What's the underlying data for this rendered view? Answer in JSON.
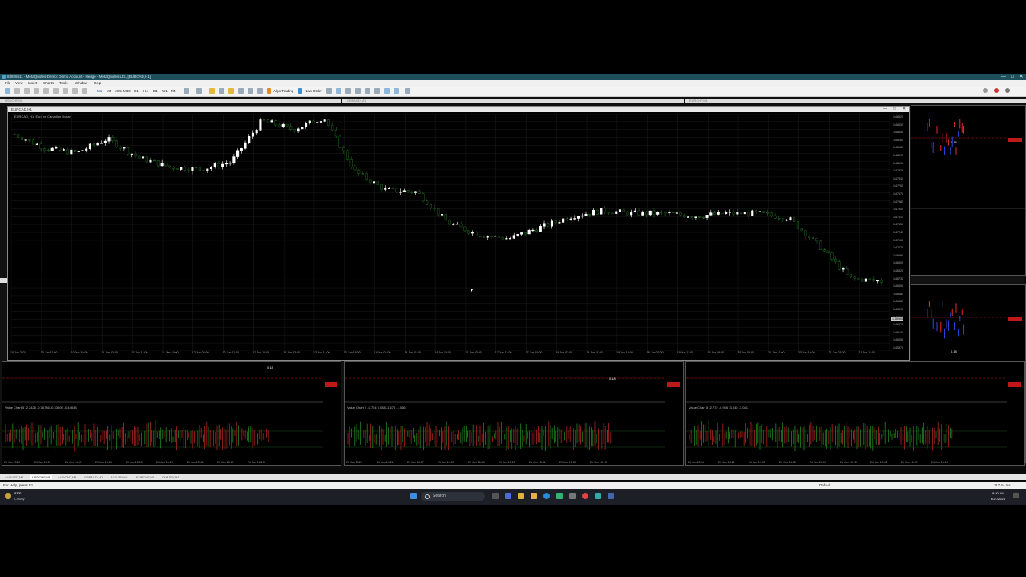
{
  "window": {
    "title": "83926611 - MetaQuotes-Demo: Demo Account - Hedge - MetaQuotes Ltd., [EURCAD,H1]",
    "controls": [
      "—",
      "□",
      "✕"
    ]
  },
  "menu": [
    "File",
    "View",
    "Insert",
    "Charts",
    "Tools",
    "Window",
    "Help"
  ],
  "toolbar": {
    "timeframes": [
      "M1",
      "M5",
      "M15",
      "M30",
      "H1",
      "H4",
      "D1",
      "W1",
      "MN"
    ],
    "algo_trading": "Algo Trading",
    "new_order": "New Order"
  },
  "child_windows": {
    "left_top": "USDCHF,M1",
    "middle_top": "GBPAUD,M1",
    "right_top": "EURCHF,M1",
    "left_bottom": "AUDUSD,M1"
  },
  "main_chart": {
    "window_title": "EURCAD,H1",
    "symbol_label": "EURCAD, H1: Euro vs Canadian Dollar",
    "x_ticks": [
      "10 Jun 2024",
      "10 Jun 11:00",
      "10 Jun 19:00",
      "11 Jun 03:00",
      "11 Jun 11:00",
      "11 Jun 19:00",
      "12 Jun 03:00",
      "12 Jun 11:00",
      "12 Jun 19:00",
      "13 Jun 03:00",
      "13 Jun 11:00",
      "13 Jun 19:00",
      "14 Jun 03:00",
      "14 Jun 11:00",
      "14 Jun 19:00",
      "17 Jun 03:00",
      "17 Jun 11:00",
      "17 Jun 19:00",
      "18 Jun 03:00",
      "18 Jun 11:00",
      "18 Jun 19:00",
      "19 Jun 03:00",
      "19 Jun 11:00",
      "19 Jun 19:00",
      "20 Jun 03:00",
      "20 Jun 11:00",
      "20 Jun 19:00",
      "21 Jun 03:00",
      "21 Jun 11:00"
    ],
    "y_ticks": [
      "1.48520",
      "1.48435",
      "1.48350",
      "1.48265",
      "1.48180",
      "1.48095",
      "1.48010",
      "1.47925",
      "1.47840",
      "1.47755",
      "1.47670",
      "1.47585",
      "1.47500",
      "1.47415",
      "1.47330",
      "1.47245",
      "1.47160",
      "1.47075",
      "1.46990",
      "1.46905",
      "1.46820",
      "1.46735",
      "1.46650",
      "1.46565",
      "1.46480",
      "1.46395",
      "1.46310",
      "1.46225",
      "1.46140",
      "1.46055",
      "1.45970"
    ],
    "bid_label": "1.46985"
  },
  "sub_charts": [
    {
      "name": "USDCHF,M1",
      "indicator": "Value Chart 5 -2.2426 -0.76786 -0.33609 -0.44643",
      "marker": "0.18",
      "x_ticks": [
        "21 Jun 2024",
        "21 Jun 14:21",
        "21 Jun 14:37",
        "21 Jun 14:53",
        "21 Jun 15:09",
        "21 Jun 15:25",
        "21 Jun 15:41",
        "21 Jun 15:57",
        "21 Jun 16:13"
      ]
    },
    {
      "name": "GBPAUD,M1",
      "indicator": "Value Chart 5 -0.754 0.088 -1.676 -1.066",
      "marker": "0.18",
      "x_ticks": [
        "21 Jun 2024",
        "21 Jun 14:21",
        "21 Jun 14:37",
        "21 Jun 14:53",
        "21 Jun 15:09",
        "21 Jun 15:25",
        "21 Jun 15:41",
        "21 Jun 15:57",
        "21 Jun 16:13"
      ]
    },
    {
      "name": "EURCHF,M1",
      "indicator": "Value Chart 5 -2.772 -0.955 -3.045 -3.081",
      "marker": "0.18",
      "x_ticks": [
        "21 Jun 2024",
        "21 Jun 14:21",
        "21 Jun 14:37",
        "21 Jun 14:53",
        "21 Jun 15:09",
        "21 Jun 15:25",
        "21 Jun 15:41",
        "21 Jun 15:57",
        "21 Jun 16:13"
      ]
    }
  ],
  "right_panel_marker": "0.18",
  "tabs": [
    "AUDUSD,M1",
    "USDCHF,M1",
    "AUDCAD,M1",
    "GBPAUD,M1",
    "AUDJPY,M1",
    "EURCHF,M1",
    "CHFJPY,M1"
  ],
  "status": {
    "help": "For Help, press F1",
    "profile": "Default",
    "traffic": "117.44 ms"
  },
  "taskbar": {
    "weather_temp": "83°F",
    "weather_desc": "Cloudy",
    "search_label": "Search",
    "time": "8:20 AM",
    "date": "6/21/2024"
  },
  "colors": {
    "bull": "#ffffff",
    "bear": "#1f6b1f",
    "grid": "#1c1c1c",
    "titlebar": "#1e4f5d",
    "sell_level": "#ff2020",
    "buy_level": "#2030ff"
  },
  "chart_data": {
    "type": "line",
    "title": "EURCAD, H1: Euro vs Canadian Dollar",
    "xlabel": "",
    "ylabel": "",
    "ylim": [
      1.4597,
      1.4852
    ],
    "x": [
      "10 Jun 2024",
      "10 Jun 11:00",
      "10 Jun 19:00",
      "11 Jun 03:00",
      "11 Jun 11:00",
      "11 Jun 19:00",
      "12 Jun 03:00",
      "12 Jun 11:00",
      "12 Jun 19:00",
      "13 Jun 03:00",
      "13 Jun 11:00",
      "13 Jun 19:00",
      "14 Jun 03:00",
      "14 Jun 11:00",
      "14 Jun 19:00",
      "17 Jun 03:00",
      "17 Jun 11:00",
      "17 Jun 19:00",
      "18 Jun 03:00",
      "18 Jun 11:00",
      "18 Jun 19:00",
      "19 Jun 03:00",
      "19 Jun 11:00",
      "19 Jun 19:00",
      "20 Jun 03:00",
      "20 Jun 11:00",
      "20 Jun 19:00",
      "21 Jun 03:00",
      "21 Jun 11:00"
    ],
    "series": [
      {
        "values": [
          1.483,
          1.4815,
          1.481,
          1.4825,
          1.4805,
          1.4795,
          1.4792,
          1.48,
          1.4845,
          1.4835,
          1.4848,
          1.479,
          1.477,
          1.4768,
          1.4735,
          1.4722,
          1.4718,
          1.473,
          1.4742,
          1.4748,
          1.4745,
          1.4745,
          1.4742,
          1.4745,
          1.4745,
          1.474,
          1.471,
          1.4675,
          1.4672
        ]
      }
    ]
  }
}
